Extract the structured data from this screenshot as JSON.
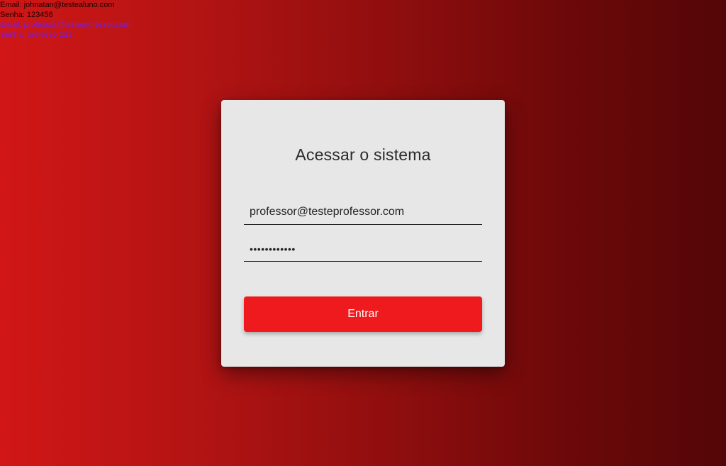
{
  "credentials": {
    "aluno_email": "Email: johnatan@testealuno.com",
    "aluno_senha": "Senha: 123456",
    "professor_email": "Email: professor@testeprofessor.com",
    "professor_senha": "Senha: professor123"
  },
  "login": {
    "title": "Acessar o sistema",
    "email_value": "professor@testeprofessor.com",
    "password_value": "professor123",
    "submit_label": "Entrar"
  },
  "colors": {
    "gradient_start": "#d11616",
    "gradient_end": "#540607",
    "button": "#ef1a1d",
    "card": "#e7e7e7",
    "link_text": "#7a1fd6"
  }
}
